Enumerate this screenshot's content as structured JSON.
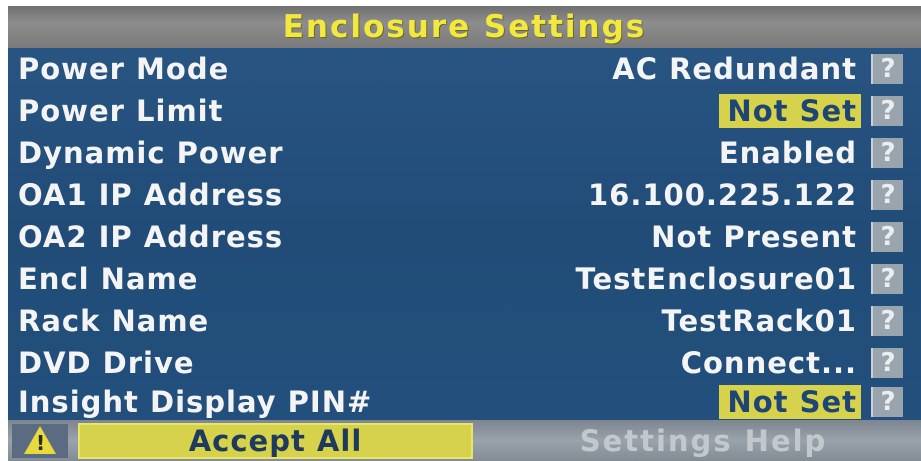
{
  "title": "Enclosure Settings",
  "help_glyph": "?",
  "rows": [
    {
      "label": "Power Mode",
      "value": "AC Redundant",
      "highlighted": false
    },
    {
      "label": "Power Limit",
      "value": "Not Set",
      "highlighted": true
    },
    {
      "label": "Dynamic Power",
      "value": "Enabled",
      "highlighted": false
    },
    {
      "label": "OA1 IP Address",
      "value": "16.100.225.122",
      "highlighted": false
    },
    {
      "label": "OA2 IP Address",
      "value": "Not Present",
      "highlighted": false
    },
    {
      "label": "Encl Name",
      "value": "TestEnclosure01",
      "highlighted": false
    },
    {
      "label": "Rack Name",
      "value": "TestRack01",
      "highlighted": false
    },
    {
      "label": "DVD Drive",
      "value": "Connect...",
      "highlighted": false
    },
    {
      "label": "Insight Display PIN#",
      "value": "Not Set",
      "highlighted": true
    }
  ],
  "bottom": {
    "warning_glyph": "!",
    "accept_label": "Accept All",
    "help_label": "Settings Help"
  },
  "colors": {
    "panel_blue": "#244f7c",
    "title_yellow": "#f2e840",
    "highlight_yellow": "#d7d24c",
    "help_gray": "#9aa4ad"
  }
}
